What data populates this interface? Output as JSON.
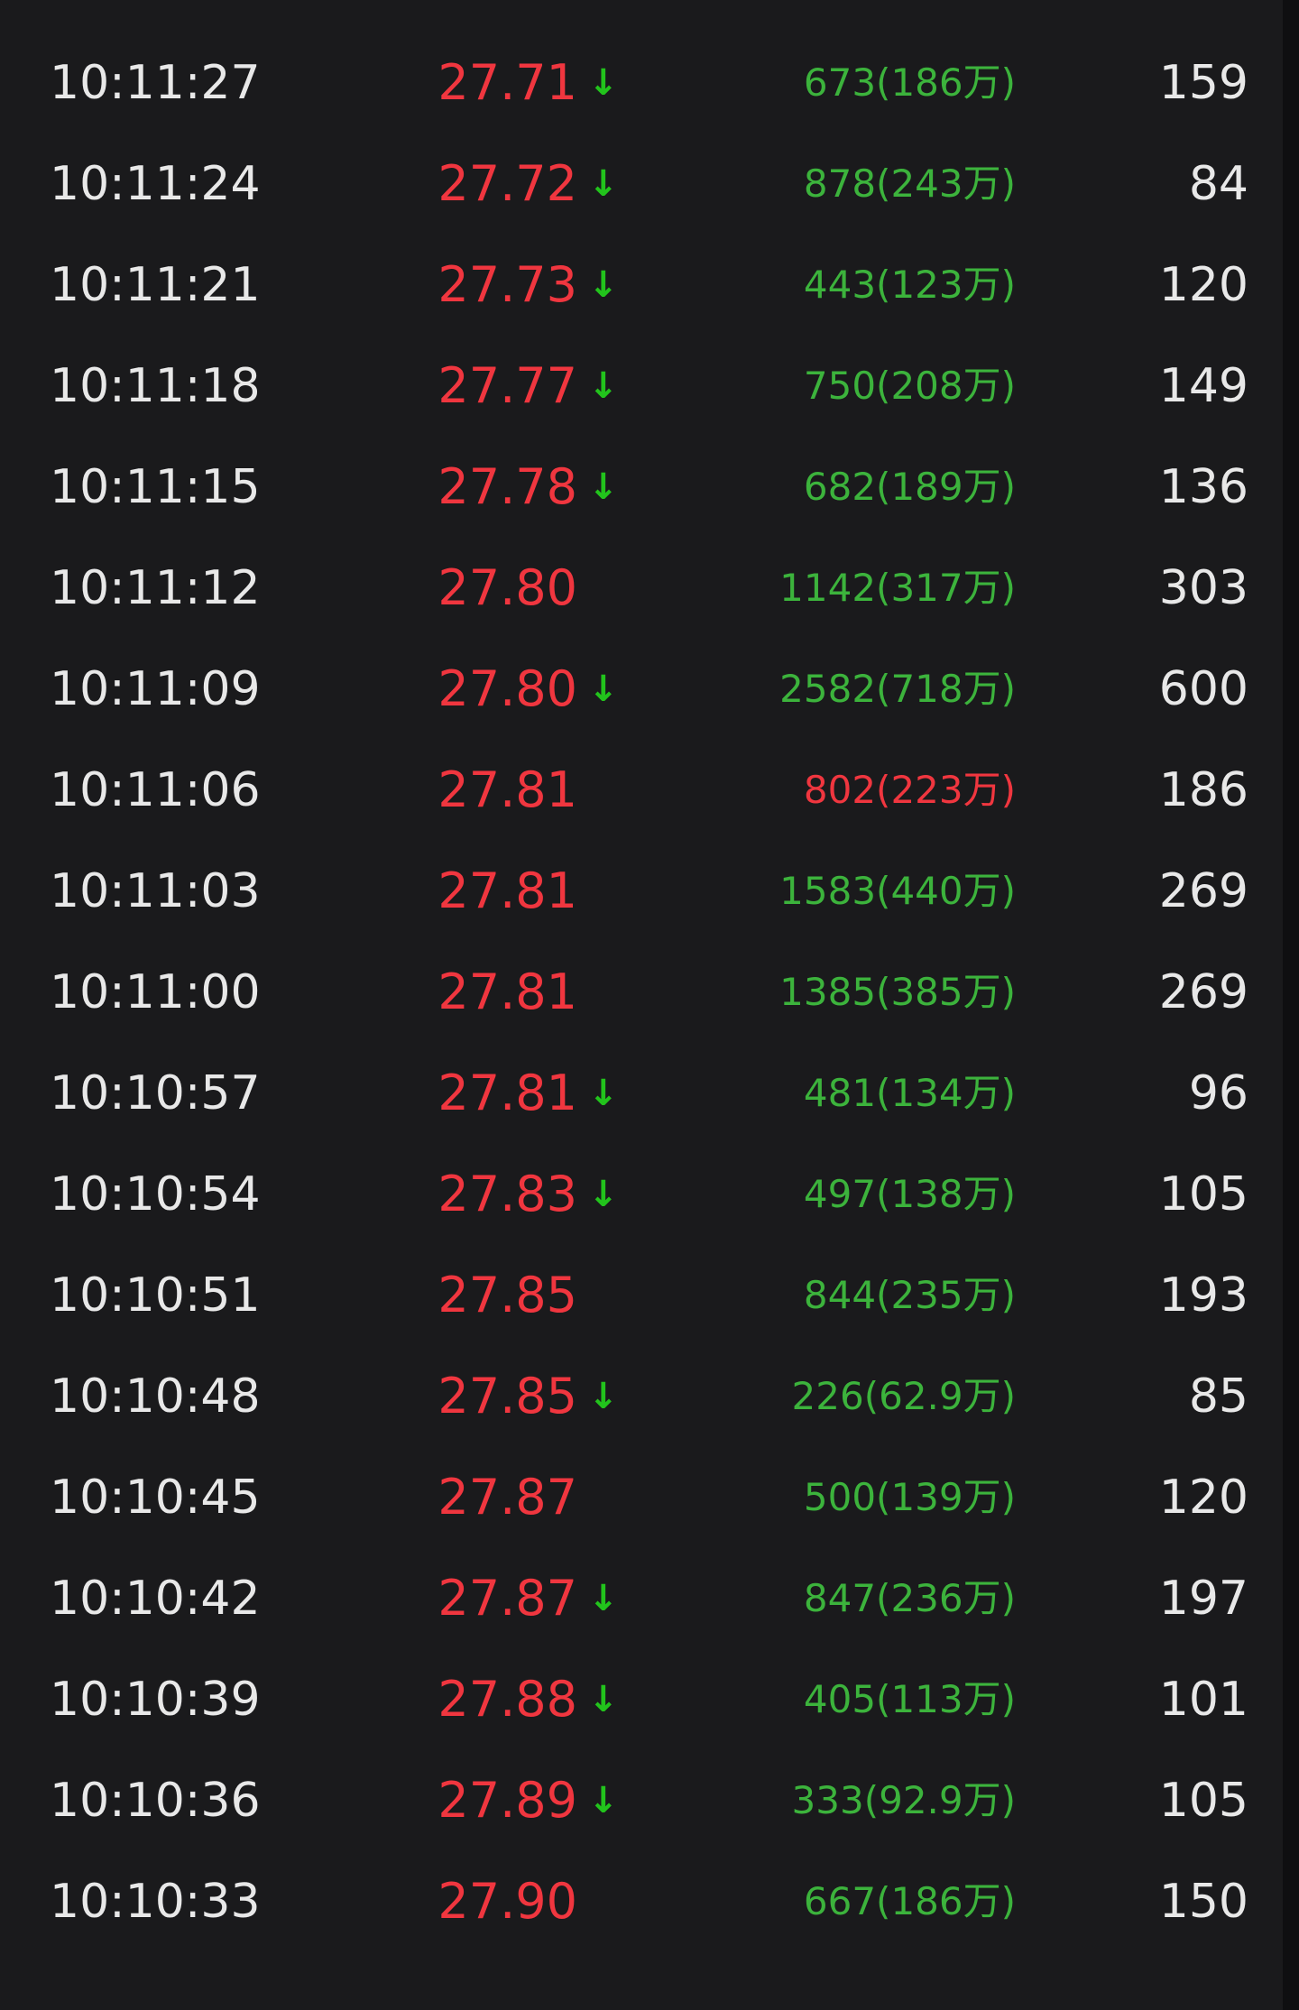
{
  "colors": {
    "background": "#1a1a1c",
    "up_red": "#f0363f",
    "down_green": "#3cb33c",
    "arrow_green": "#22c31c",
    "text": "#e8e8e8"
  },
  "trades": [
    {
      "time": "10:11:27",
      "price": "27.71",
      "arrow": "↓",
      "volume": "673(186万)",
      "vol_color": "green",
      "count": "159"
    },
    {
      "time": "10:11:24",
      "price": "27.72",
      "arrow": "↓",
      "volume": "878(243万)",
      "vol_color": "green",
      "count": "84"
    },
    {
      "time": "10:11:21",
      "price": "27.73",
      "arrow": "↓",
      "volume": "443(123万)",
      "vol_color": "green",
      "count": "120"
    },
    {
      "time": "10:11:18",
      "price": "27.77",
      "arrow": "↓",
      "volume": "750(208万)",
      "vol_color": "green",
      "count": "149"
    },
    {
      "time": "10:11:15",
      "price": "27.78",
      "arrow": "↓",
      "volume": "682(189万)",
      "vol_color": "green",
      "count": "136"
    },
    {
      "time": "10:11:12",
      "price": "27.80",
      "arrow": "",
      "volume": "1142(317万)",
      "vol_color": "green",
      "count": "303"
    },
    {
      "time": "10:11:09",
      "price": "27.80",
      "arrow": "↓",
      "volume": "2582(718万)",
      "vol_color": "green",
      "count": "600"
    },
    {
      "time": "10:11:06",
      "price": "27.81",
      "arrow": "",
      "volume": "802(223万)",
      "vol_color": "red",
      "count": "186"
    },
    {
      "time": "10:11:03",
      "price": "27.81",
      "arrow": "",
      "volume": "1583(440万)",
      "vol_color": "green",
      "count": "269"
    },
    {
      "time": "10:11:00",
      "price": "27.81",
      "arrow": "",
      "volume": "1385(385万)",
      "vol_color": "green",
      "count": "269"
    },
    {
      "time": "10:10:57",
      "price": "27.81",
      "arrow": "↓",
      "volume": "481(134万)",
      "vol_color": "green",
      "count": "96"
    },
    {
      "time": "10:10:54",
      "price": "27.83",
      "arrow": "↓",
      "volume": "497(138万)",
      "vol_color": "green",
      "count": "105"
    },
    {
      "time": "10:10:51",
      "price": "27.85",
      "arrow": "",
      "volume": "844(235万)",
      "vol_color": "green",
      "count": "193"
    },
    {
      "time": "10:10:48",
      "price": "27.85",
      "arrow": "↓",
      "volume": "226(62.9万)",
      "vol_color": "green",
      "count": "85"
    },
    {
      "time": "10:10:45",
      "price": "27.87",
      "arrow": "",
      "volume": "500(139万)",
      "vol_color": "green",
      "count": "120"
    },
    {
      "time": "10:10:42",
      "price": "27.87",
      "arrow": "↓",
      "volume": "847(236万)",
      "vol_color": "green",
      "count": "197"
    },
    {
      "time": "10:10:39",
      "price": "27.88",
      "arrow": "↓",
      "volume": "405(113万)",
      "vol_color": "green",
      "count": "101"
    },
    {
      "time": "10:10:36",
      "price": "27.89",
      "arrow": "↓",
      "volume": "333(92.9万)",
      "vol_color": "green",
      "count": "105"
    },
    {
      "time": "10:10:33",
      "price": "27.90",
      "arrow": "",
      "volume": "667(186万)",
      "vol_color": "green",
      "count": "150"
    }
  ]
}
